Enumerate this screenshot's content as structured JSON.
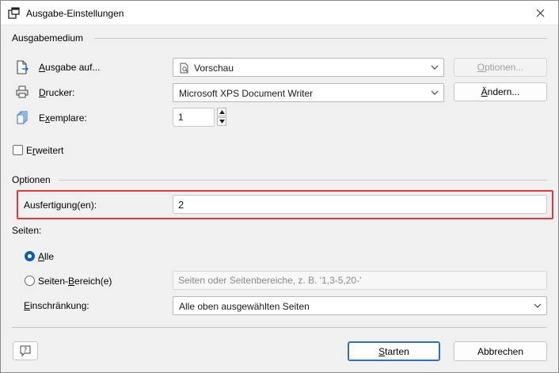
{
  "window": {
    "title": "Ausgabe-Einstellungen"
  },
  "ausgabemedium": {
    "heading": "Ausgabemedium",
    "ausgabe_label_u": "A",
    "ausgabe_label_rest": "usgabe auf...",
    "ausgabe_value": "Vorschau",
    "optionen_button_pre": "O",
    "optionen_button_rest": "ptionen...",
    "drucker_label_u": "D",
    "drucker_label_rest": "rucker:",
    "drucker_value": "Microsoft XPS Document Writer",
    "aendern_button_u": "Ä",
    "aendern_button_rest": "ndern...",
    "exemplare_label_pre": "E",
    "exemplare_label_u": "x",
    "exemplare_label_rest": "emplare:",
    "exemplare_value": "1",
    "erweitert_pre": "E",
    "erweitert_u": "r",
    "erweitert_rest": "weitert"
  },
  "optionen": {
    "heading": "Optionen",
    "ausfertigung_label": "Ausfertigung(en):",
    "ausfertigung_value": "2"
  },
  "seiten": {
    "heading": "Seiten:",
    "alle_u": "A",
    "alle_rest": "lle",
    "bereich_pre": "Seiten-",
    "bereich_u": "B",
    "bereich_rest": "ereich(e)",
    "bereich_placeholder": "Seiten oder Seitenbereiche, z. B. '1,3-5,20-'",
    "einschraenkung_u": "E",
    "einschraenkung_rest": "inschränkung:",
    "einschraenkung_value": "Alle oben ausgewählten Seiten"
  },
  "footer": {
    "starten_u": "S",
    "starten_rest": "tarten",
    "abbrechen_label": "Abbrechen"
  },
  "colors": {
    "highlight": "#e03a3a",
    "accent": "#0a5fb4"
  }
}
